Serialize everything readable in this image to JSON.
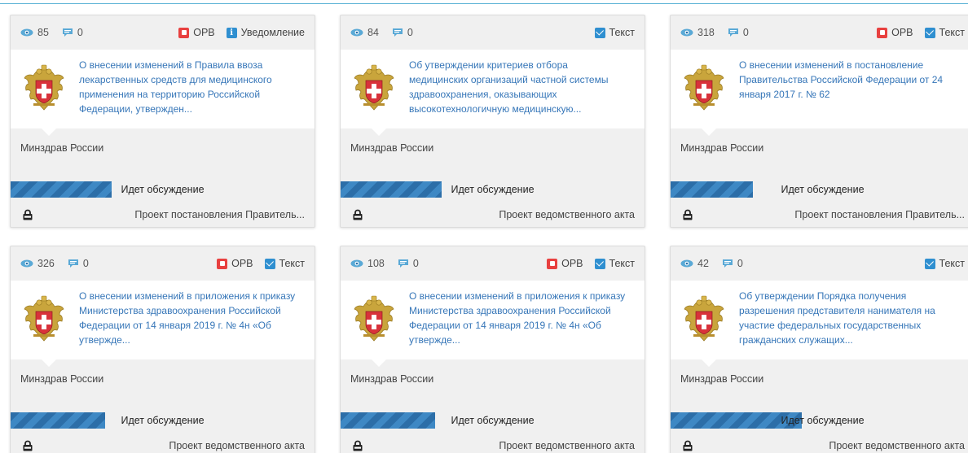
{
  "cards": [
    {
      "views": "85",
      "comments": "0",
      "tags": [
        "ОРВ",
        "Уведомление"
      ],
      "tag_icons": [
        "orv-icon",
        "info-icon"
      ],
      "title": "О внесении изменений в Правила ввоза лекарственных средств для медицинского применения на территорию Российской Федерации, утвержден...",
      "org": "Минздрав России",
      "progress": 0.33,
      "status": "Идет обсуждение",
      "doctype": "Проект постановления Правитель..."
    },
    {
      "views": "84",
      "comments": "0",
      "tags": [
        "Текст"
      ],
      "tag_icons": [
        "text-icon"
      ],
      "title": "Об утверждении критериев отбора медицинских организаций частной системы здравоохранения, оказывающих высокотехнологичную медицинскую...",
      "org": "Минздрав России",
      "progress": 0.33,
      "status": "Идет обсуждение",
      "doctype": "Проект ведомственного акта"
    },
    {
      "views": "318",
      "comments": "0",
      "tags": [
        "ОРВ",
        "Текст"
      ],
      "tag_icons": [
        "orv-icon",
        "text-icon"
      ],
      "title": "О внесении изменений в постановление Правительства Российской Федерации от 24 января 2017 г. № 62",
      "org": "Минздрав России",
      "progress": 0.27,
      "status": "Идет обсуждение",
      "doctype": "Проект постановления Правитель..."
    },
    {
      "views": "326",
      "comments": "0",
      "tags": [
        "ОРВ",
        "Текст"
      ],
      "tag_icons": [
        "orv-icon",
        "text-icon"
      ],
      "title": "О внесении изменений в приложения к приказу Министерства здравоохранения Российской Федерации от 14 января 2019 г. № 4н «Об утвержде...",
      "org": "Минздрав России",
      "progress": 0.31,
      "status": "Идет обсуждение",
      "doctype": "Проект ведомственного акта"
    },
    {
      "views": "108",
      "comments": "0",
      "tags": [
        "ОРВ",
        "Текст"
      ],
      "tag_icons": [
        "orv-icon",
        "text-icon"
      ],
      "title": "О внесении изменений в приложения к приказу Министерства здравоохранения Российской Федерации от 14 января 2019 г. № 4н «Об утвержде...",
      "org": "Минздрав России",
      "progress": 0.31,
      "status": "Идет обсуждение",
      "doctype": "Проект ведомственного акта"
    },
    {
      "views": "42",
      "comments": "0",
      "tags": [
        "Текст"
      ],
      "tag_icons": [
        "text-icon"
      ],
      "title": "Об утверждении Порядка получения разрешения представителя нанимателя на участие федеральных государственных гражданских служащих...",
      "org": "Минздрав России",
      "progress": 0.43,
      "status": "Идет обсуждение",
      "doctype": "Проект ведомственного акта"
    }
  ],
  "colors": {
    "title_link": "#3676b8",
    "progress": "#2c6ea8",
    "orv_tag": "#e8403f",
    "text_tag": "#2f8fd0",
    "top_line": "#5bb3d6"
  }
}
